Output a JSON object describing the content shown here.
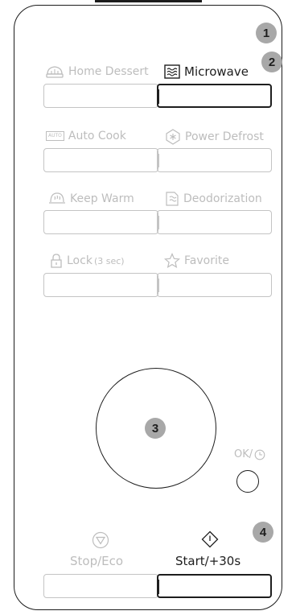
{
  "badges": [
    "1",
    "2",
    "3",
    "4"
  ],
  "rows": [
    {
      "left": {
        "label": "Home Dessert",
        "icon": "home-dessert-icon",
        "active": false
      },
      "right": {
        "label": "Microwave",
        "icon": "microwave-icon",
        "active": true
      }
    },
    {
      "left": {
        "label": "Auto Cook",
        "icon": "auto-cook-icon",
        "active": false
      },
      "right": {
        "label": "Power Defrost",
        "icon": "power-defrost-icon",
        "active": false
      }
    },
    {
      "left": {
        "label": "Keep Warm",
        "icon": "keep-warm-icon",
        "active": false
      },
      "right": {
        "label": "Deodorization",
        "icon": "deodorization-icon",
        "active": false
      }
    },
    {
      "left": {
        "label": "Lock",
        "sub": "(3 sec)",
        "icon": "lock-icon",
        "active": false
      },
      "right": {
        "label": "Favorite",
        "icon": "favorite-icon",
        "active": false
      }
    }
  ],
  "auto_icon_text": "AUTO",
  "ok": {
    "label": "OK/",
    "icon": "clock-icon"
  },
  "stop": {
    "label": "Stop/Eco",
    "icon": "stop-triangle-icon"
  },
  "start": {
    "label": "Start/+30s",
    "icon": "start-diamond-icon"
  },
  "colors": {
    "active": "#1e1e1e",
    "inactive": "#bdbdbd",
    "badge": "#a8a8a8"
  }
}
